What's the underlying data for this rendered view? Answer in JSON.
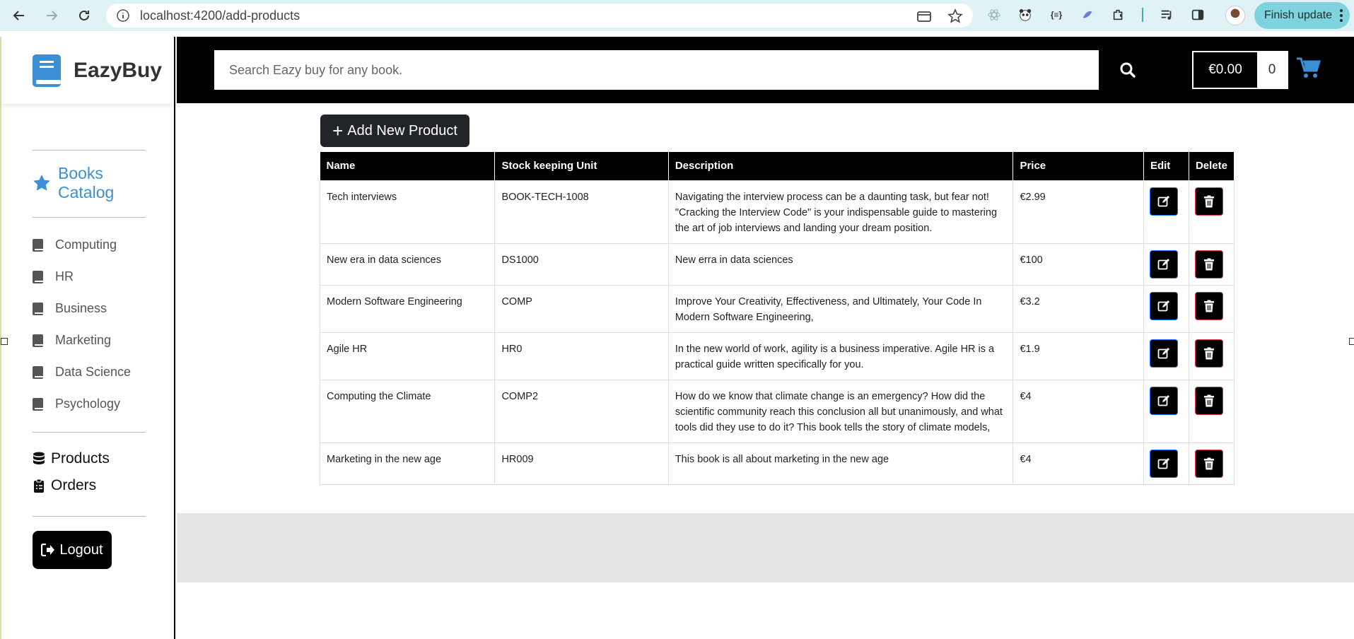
{
  "browser": {
    "url": "localhost:4200/add-products",
    "finish_update_label": "Finish update",
    "extensions_glyph": "{≡}"
  },
  "sidebar": {
    "brand": "EazyBuy",
    "catalog_title": "Books Catalog",
    "categories": [
      {
        "label": "Computing"
      },
      {
        "label": "HR"
      },
      {
        "label": "Business"
      },
      {
        "label": "Marketing"
      },
      {
        "label": "Data Science"
      },
      {
        "label": "Psychology"
      }
    ],
    "admin": {
      "products_label": "Products",
      "orders_label": "Orders"
    },
    "logout_label": "Logout"
  },
  "header": {
    "search_placeholder": "Search Eazy buy for any book.",
    "cart_total": "€0.00",
    "cart_count": "0"
  },
  "main": {
    "add_button_label": "Add New Product",
    "columns": {
      "name": "Name",
      "sku": "Stock keeping Unit",
      "description": "Description",
      "price": "Price",
      "edit": "Edit",
      "delete": "Delete"
    },
    "rows": [
      {
        "name": "Tech interviews",
        "sku": "BOOK-TECH-1008",
        "description": "Navigating the interview process can be a daunting task, but fear not! \"Cracking the Interview Code\" is your indispensable guide to mastering the art of job interviews and landing your dream position.",
        "price": "€2.99"
      },
      {
        "name": "New era in data sciences",
        "sku": "DS1000",
        "description": "New erra in data sciences",
        "price": "€100"
      },
      {
        "name": "Modern Software Engineering",
        "sku": "COMP",
        "description": "Improve Your Creativity, Effectiveness, and Ultimately, Your Code In Modern Software Engineering,",
        "price": "€3.2"
      },
      {
        "name": "Agile HR",
        "sku": "HR0",
        "description": "In the new world of work, agility is a business imperative. Agile HR is a practical guide written specifically for you.",
        "price": "€1.9"
      },
      {
        "name": "Computing the Climate",
        "sku": "COMP2",
        "description": "How do we know that climate change is an emergency? How did the scientific community reach this conclusion all but unanimously, and what tools did they use to do it? This book tells the story of climate models,",
        "price": "€4"
      },
      {
        "name": "Marketing in the new age",
        "sku": "HR009",
        "description": "This book is all about marketing in the new age",
        "price": "€4"
      }
    ]
  },
  "colors": {
    "brand_blue": "#3a8fd6",
    "header_bg": "#000000",
    "chrome_bg": "#dff3f6",
    "update_pill": "#7fd3dc"
  },
  "icons": [
    "back-icon",
    "forward-icon",
    "reload-icon",
    "info-icon",
    "card-icon",
    "star-icon",
    "react-icon",
    "panda-icon",
    "extension-icon",
    "puzzle-icon",
    "media-icon",
    "sidepanel-icon",
    "search-icon",
    "cart-icon",
    "book-icon",
    "star-catalog-icon",
    "database-icon",
    "clipboard-icon",
    "logout-icon",
    "edit-icon",
    "trash-icon"
  ]
}
